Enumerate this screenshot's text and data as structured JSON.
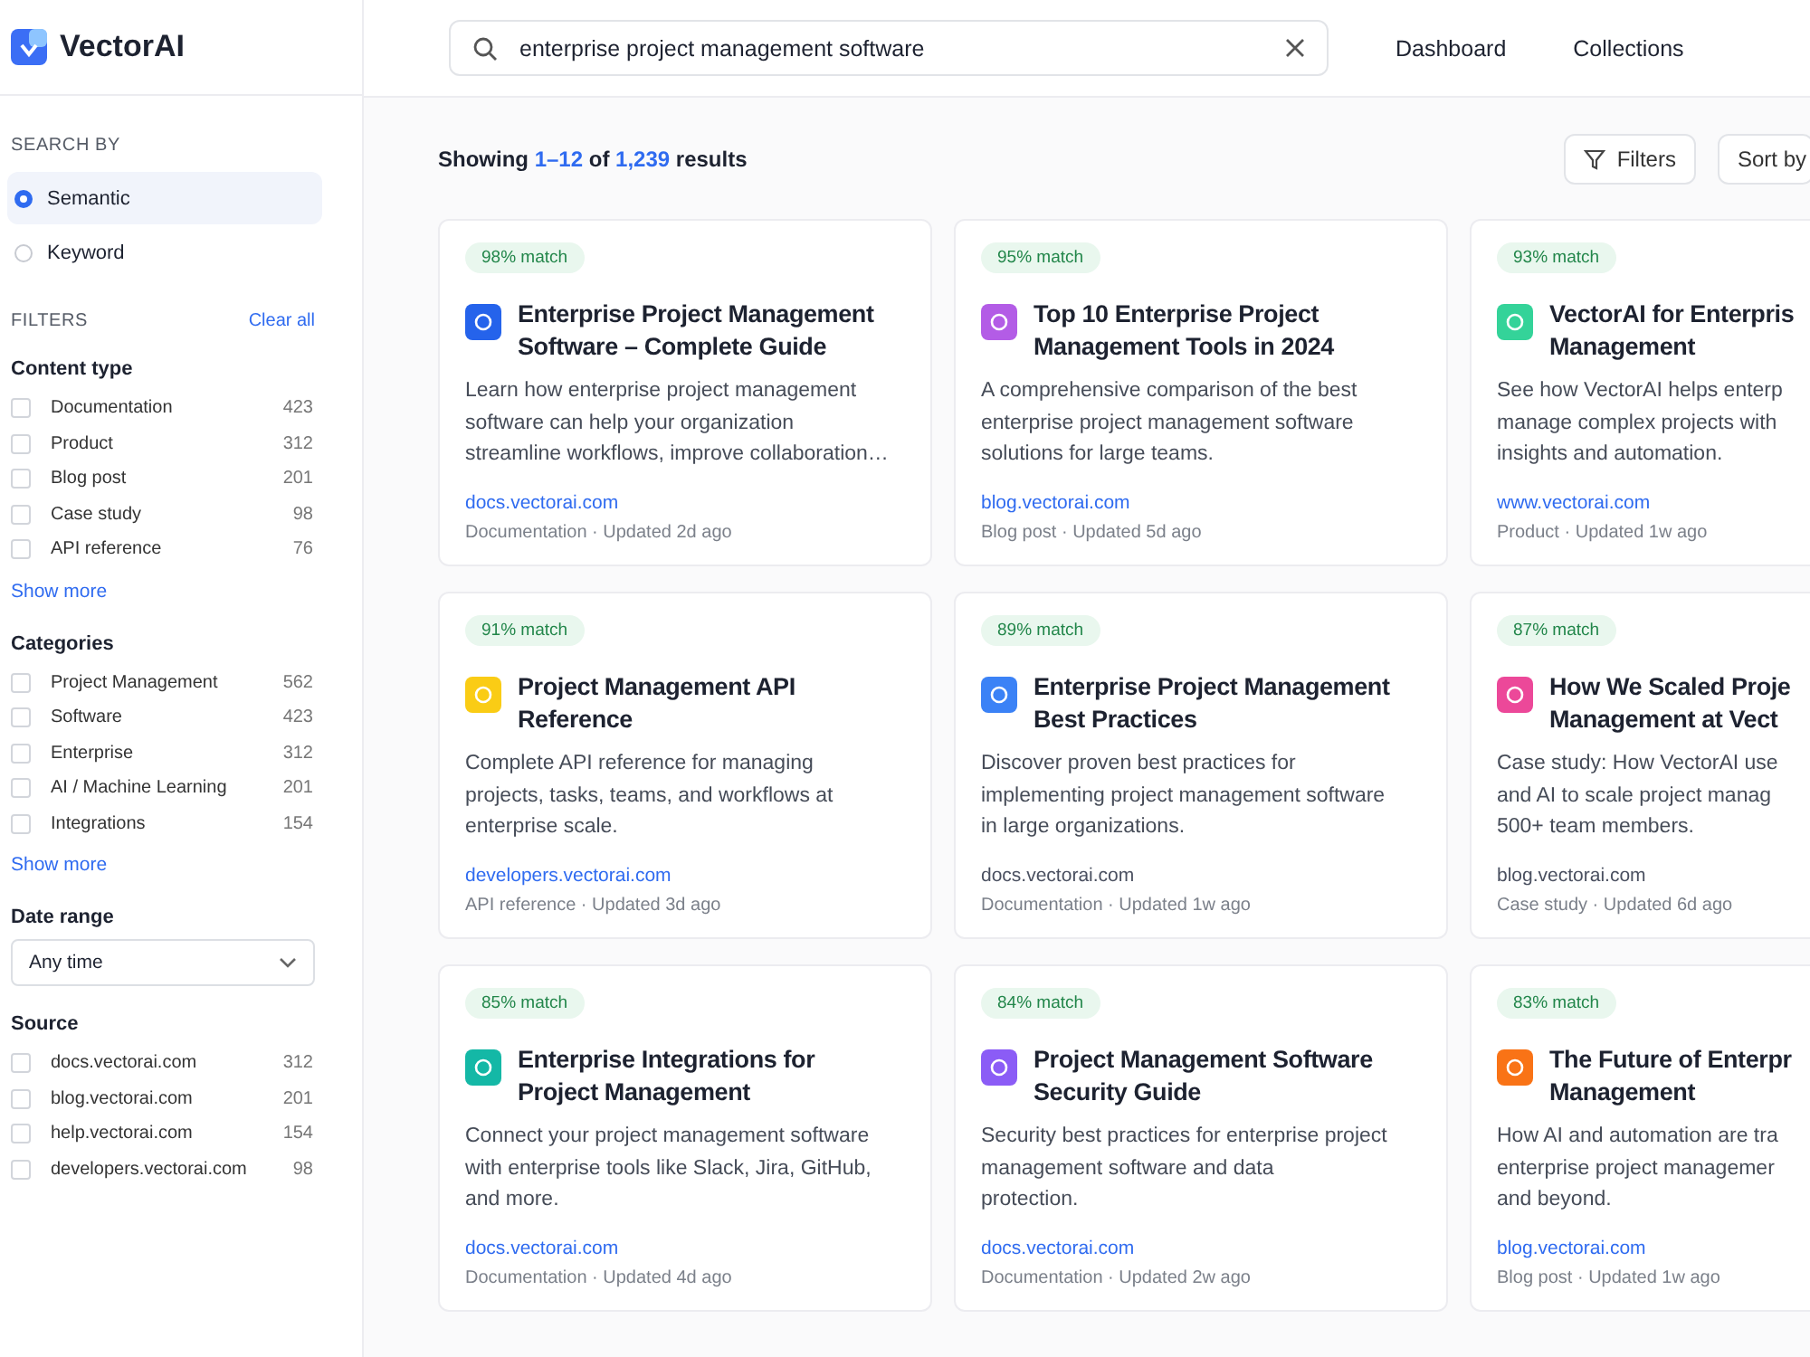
{
  "brand": {
    "name": "VectorAI"
  },
  "search_by": {
    "heading": "SEARCH BY",
    "options": [
      {
        "label": "Semantic",
        "selected": true
      },
      {
        "label": "Keyword",
        "selected": false
      }
    ]
  },
  "filters": {
    "heading": "FILTERS",
    "clear": "Clear all",
    "groups": [
      {
        "kind": "checklist",
        "title": "Content type",
        "more": "Show more",
        "items": [
          {
            "label": "Documentation",
            "count": "423",
            "checked": false
          },
          {
            "label": "Product",
            "count": "312",
            "checked": false
          },
          {
            "label": "Blog post",
            "count": "201",
            "checked": false
          },
          {
            "label": "Case study",
            "count": "98",
            "checked": false
          },
          {
            "label": "API reference",
            "count": "76",
            "checked": false
          }
        ]
      },
      {
        "kind": "checklist",
        "title": "Categories",
        "more": "Show more",
        "items": [
          {
            "label": "Project Management",
            "count": "562",
            "checked": false
          },
          {
            "label": "Software",
            "count": "423",
            "checked": false
          },
          {
            "label": "Enterprise",
            "count": "312",
            "checked": false
          },
          {
            "label": "AI / Machine Learning",
            "count": "201",
            "checked": false
          },
          {
            "label": "Integrations",
            "count": "154",
            "checked": false
          }
        ]
      },
      {
        "kind": "select",
        "title": "Date range",
        "value": "Any time"
      },
      {
        "kind": "checklist",
        "title": "Source",
        "items": [
          {
            "label": "docs.vectorai.com",
            "count": "312",
            "checked": false
          },
          {
            "label": "blog.vectorai.com",
            "count": "201",
            "checked": false
          },
          {
            "label": "help.vectorai.com",
            "count": "154",
            "checked": false
          },
          {
            "label": "developers.vectorai.com",
            "count": "98",
            "checked": false
          }
        ]
      }
    ]
  },
  "search": {
    "value": "enterprise project management software"
  },
  "nav": [
    "Dashboard",
    "Collections"
  ],
  "summary": {
    "prefix": "Showing",
    "range": "1–12",
    "middle": "of",
    "total": "1,239",
    "suffix": "results"
  },
  "toolbar": {
    "filters": "Filters",
    "sort": "Sort by"
  },
  "results": [
    {
      "match": "98% match",
      "color": "#2563eb",
      "title_lines": [
        "Enterprise Project Management",
        "Software – Complete Guide"
      ],
      "description_lines": [
        "Learn how enterprise project management",
        "software can help your organization",
        "streamline workflows, improve collaboration…"
      ],
      "source": "docs.vectorai.com",
      "visited": false,
      "meta": "Documentation · Updated 2d ago"
    },
    {
      "match": "95% match",
      "color": "#b35ce6",
      "title_lines": [
        "Top 10 Enterprise Project",
        "Management Tools in 2024"
      ],
      "description_lines": [
        "A comprehensive comparison of the best",
        "enterprise project management software",
        "solutions for large teams."
      ],
      "source": "blog.vectorai.com",
      "visited": false,
      "meta": "Blog post · Updated 5d ago"
    },
    {
      "match": "93% match",
      "color": "#34d399",
      "title_lines": [
        "VectorAI for Enterpris",
        "Management"
      ],
      "description_lines": [
        "See how VectorAI helps enterp",
        "manage complex projects with",
        "insights and automation."
      ],
      "source": "www.vectorai.com",
      "visited": false,
      "meta": "Product · Updated 1w ago"
    },
    {
      "match": "91% match",
      "color": "#facc15",
      "title_lines": [
        "Project Management API",
        "Reference"
      ],
      "description_lines": [
        "Complete API reference for managing",
        "projects, tasks, teams, and workflows at",
        "enterprise scale."
      ],
      "source": "developers.vectorai.com",
      "visited": false,
      "meta": "API reference · Updated 3d ago"
    },
    {
      "match": "89% match",
      "color": "#3b82f6",
      "title_lines": [
        "Enterprise Project Management",
        "Best Practices"
      ],
      "description_lines": [
        "Discover proven best practices for",
        "implementing project management software",
        "in large organizations."
      ],
      "source": "docs.vectorai.com",
      "visited": true,
      "meta": "Documentation · Updated 1w ago"
    },
    {
      "match": "87% match",
      "color": "#ec4899",
      "title_lines": [
        "How We Scaled Proje",
        "Management at Vect"
      ],
      "description_lines": [
        "Case study: How VectorAI use",
        "and AI to scale project manag",
        "500+ team members."
      ],
      "source": "blog.vectorai.com",
      "visited": true,
      "meta": "Case study · Updated 6d ago"
    },
    {
      "match": "85% match",
      "color": "#14b8a6",
      "title_lines": [
        "Enterprise Integrations for",
        "Project Management"
      ],
      "description_lines": [
        "Connect your project management software",
        "with enterprise tools like Slack, Jira, GitHub,",
        "and more."
      ],
      "source": "docs.vectorai.com",
      "visited": false,
      "meta": "Documentation · Updated 4d ago"
    },
    {
      "match": "84% match",
      "color": "#8b5cf6",
      "title_lines": [
        "Project Management Software",
        "Security Guide"
      ],
      "description_lines": [
        "Security best practices for enterprise project",
        "management software and data",
        "protection."
      ],
      "source": "docs.vectorai.com",
      "visited": false,
      "meta": "Documentation · Updated 2w ago"
    },
    {
      "match": "83% match",
      "color": "#f97316",
      "title_lines": [
        "The Future of Enterpr",
        "Management"
      ],
      "description_lines": [
        "How AI and automation are tra",
        "enterprise project managemer",
        "and beyond."
      ],
      "source": "blog.vectorai.com",
      "visited": false,
      "meta": "Blog post · Updated 1w ago"
    }
  ]
}
